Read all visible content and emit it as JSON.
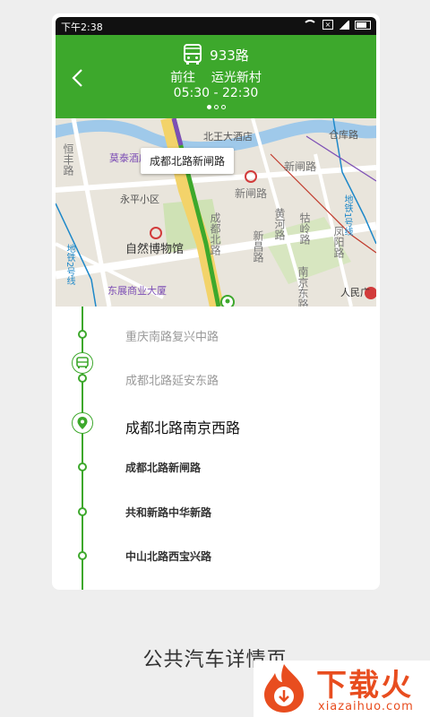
{
  "status_bar": {
    "time": "下午2:38"
  },
  "header": {
    "route": "933路",
    "direction_prefix": "前往",
    "destination": "运光新村",
    "hours": "05:30  -  22:30",
    "page_dots": 3,
    "active_dot": 0
  },
  "map": {
    "callout": "成都北路新闸路",
    "labels": {
      "beijing_hotel": "北王大酒店",
      "warehouse": "仓库路",
      "hengfeng": "恒丰路",
      "motai": "莫泰酒店",
      "xinzha_road": "新闸路",
      "xinzha": "新闸路",
      "yongping": "永平小区",
      "museum": "自然博物馆",
      "huanghe": "黄河路",
      "guling": "牯岭路",
      "fengyang": "凤阳路",
      "xinchang": "新昌路",
      "dongzhan": "东展商业大厦",
      "nanjing_rd": "南京东路",
      "peoples": "人民广",
      "chengdu_bei": "成都北路",
      "line1": "地铁1号线",
      "line2": "地铁2号线"
    }
  },
  "stops": [
    {
      "name": "重庆南路复兴中路",
      "state": "passed"
    },
    {
      "name": "成都北路延安东路",
      "state": "passed"
    },
    {
      "name": "成都北路南京西路",
      "state": "current"
    },
    {
      "name": "成都北路新闸路",
      "state": "next"
    },
    {
      "name": "共和新路中华新路",
      "state": "upcoming"
    },
    {
      "name": "中山北路西宝兴路",
      "state": "upcoming"
    }
  ],
  "caption": "公共汽车详情页",
  "logo": {
    "text": "下载火",
    "sub": "xiazaihuo.com"
  },
  "colors": {
    "accent": "#3da82c",
    "logo": "#e84d1f"
  }
}
